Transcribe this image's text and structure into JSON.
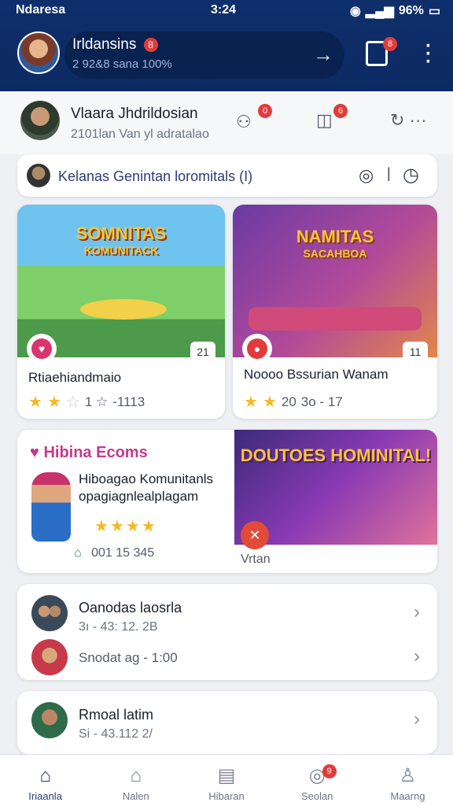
{
  "status_bar": {
    "left": "Ndaresa",
    "time": "3:24",
    "right": "96%"
  },
  "header": {
    "name": "Irldansins",
    "name_badge": "8",
    "subtitle": "2 92&8 sana 100%",
    "doc_badge": "8"
  },
  "profile": {
    "name": "Vlaara Jhdrildosian",
    "subtitle": "2101lan Van yl adratalao",
    "badge1": "0",
    "badge2": "6"
  },
  "community_pill": {
    "text": "Kelanas Genintan loromitals (I)"
  },
  "cards": [
    {
      "image_title": "SOMNITAS",
      "image_subtitle": "KOMUNITACK",
      "title": "Rtiaehiandmaio",
      "rating_value": "1 ☆",
      "rating_text": "-1113",
      "tag": "21",
      "chip": "♥"
    },
    {
      "image_title": "NAMITAS",
      "image_subtitle": "SACAHBOA",
      "title": "Noooo Bssurian Wanam",
      "rating_value": "20",
      "rating_text": "3o - 17",
      "tag": "11",
      "chip": "●"
    }
  ],
  "feature": {
    "title": "Hibina Ecoms",
    "desc": "Hiboagao Komunitanls opagiagnlealplagam",
    "meta": "001 15  345",
    "image_title": "DOUTOES HOMINITAL!",
    "image_label": "Vrtan",
    "chip": "✕"
  },
  "list1": [
    {
      "title": "Oanodas laosrla",
      "sub": "3ı - 43: 12. 2B"
    },
    {
      "title": "",
      "sub": "Snodat ag - 1:00"
    }
  ],
  "list2": [
    {
      "title": "Rmoal latim",
      "sub": "Si - 43.112 2/"
    }
  ],
  "nav": [
    {
      "label": "Iriaanla",
      "icon": "home-icon",
      "active": true
    },
    {
      "label": "Nalen",
      "icon": "house-outline-icon",
      "active": false
    },
    {
      "label": "Hibaran",
      "icon": "document-icon",
      "active": false
    },
    {
      "label": "Seolan",
      "icon": "target-icon",
      "active": false,
      "badge": "9"
    },
    {
      "label": "Maarng",
      "icon": "user-icon",
      "active": false
    }
  ],
  "colors": {
    "header": "#0f2f6c",
    "accent": "#2a3f72",
    "badge": "#e23b3b",
    "star": "#f5b921"
  }
}
